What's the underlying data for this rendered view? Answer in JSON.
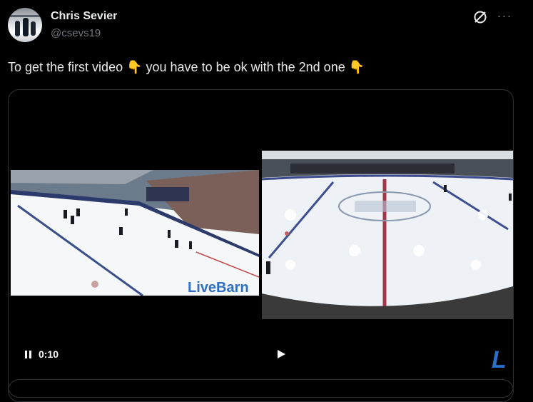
{
  "author": {
    "name": "Chris Sevier",
    "handle": "@csevs19"
  },
  "icons": {
    "avatar": "avatar-photo",
    "grok": "grok-slash-circle-icon",
    "more": "more-dots-icon",
    "pause": "pause-icon",
    "play": "play-icon"
  },
  "tweet": {
    "text_part1": "To get the first video ",
    "emoji1": "👇",
    "text_part2": " you have to be ok with the 2nd one ",
    "emoji2": "👇"
  },
  "video": {
    "time": "0:10",
    "left_watermark": "LiveBarn",
    "corner_brand": "L"
  },
  "colors": {
    "background": "#000000",
    "text": "#e7e9ea",
    "secondary": "#71767b",
    "border": "#2f3336",
    "livebarn_blue": "#2a6fc9"
  }
}
